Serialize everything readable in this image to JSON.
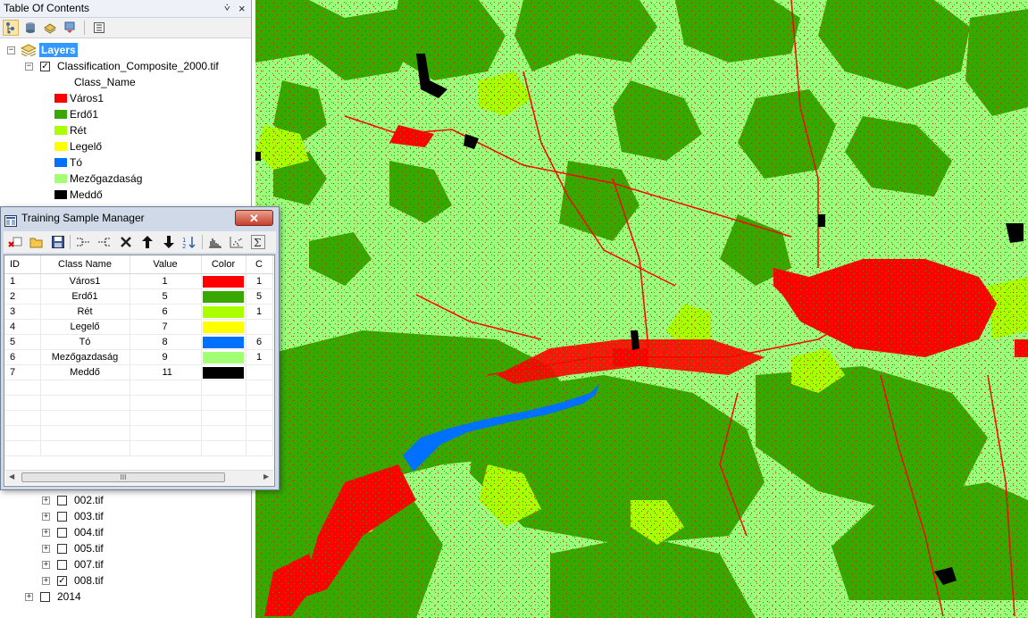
{
  "toc": {
    "title": "Table Of Contents",
    "pin_glyph": "⩒",
    "close_glyph": "×",
    "toolbar_icons": [
      "list-by-drawing-order-icon",
      "list-by-source-icon",
      "list-by-visibility-icon",
      "list-by-selection-icon",
      "options-icon"
    ],
    "layers_label": "Layers",
    "raster_layer": "Classification_Composite_2000.tif",
    "legend_field": "Class_Name",
    "legend": [
      {
        "label": "Város1",
        "color": "#ff0000"
      },
      {
        "label": "Erdő1",
        "color": "#38a800"
      },
      {
        "label": "Rét",
        "color": "#aaff00"
      },
      {
        "label": "Legelő",
        "color": "#ffff00"
      },
      {
        "label": "Tó",
        "color": "#0070ff"
      },
      {
        "label": "Mezőgazdaság",
        "color": "#a3ff73"
      },
      {
        "label": "Meddő",
        "color": "#000000"
      }
    ],
    "lower_layers": [
      {
        "label": "002.tif",
        "checked": false
      },
      {
        "label": "003.tif",
        "checked": false
      },
      {
        "label": "004.tif",
        "checked": false
      },
      {
        "label": "005.tif",
        "checked": false
      },
      {
        "label": "007.tif",
        "checked": false
      },
      {
        "label": "008.tif",
        "checked": true
      }
    ],
    "group_2014": "2014"
  },
  "training_sample_manager": {
    "title": "Training Sample Manager",
    "close_glyph": "✕",
    "toolbar_icons": [
      "delete-icon",
      "open-icon",
      "save-icon",
      "merge-icon",
      "split-icon",
      "remove-icon",
      "move-up-icon",
      "move-down-icon",
      "reset-order-icon",
      "histogram-icon",
      "scatterplot-icon",
      "statistics-icon"
    ],
    "columns": [
      "ID",
      "Class Name",
      "Value",
      "Color",
      "C"
    ],
    "rows": [
      {
        "id": "1",
        "name": "Város1",
        "value": "1",
        "color": "#ff0000",
        "c": "1"
      },
      {
        "id": "2",
        "name": "Erdő1",
        "value": "5",
        "color": "#38a800",
        "c": "5"
      },
      {
        "id": "3",
        "name": "Rét",
        "value": "6",
        "color": "#aaff00",
        "c": "1"
      },
      {
        "id": "4",
        "name": "Legelő",
        "value": "7",
        "color": "#ffff00",
        "c": ""
      },
      {
        "id": "5",
        "name": "Tó",
        "value": "8",
        "color": "#0070ff",
        "c": "6"
      },
      {
        "id": "6",
        "name": "Mezőgazdaság",
        "value": "9",
        "color": "#a3ff73",
        "c": "1"
      },
      {
        "id": "7",
        "name": "Meddő",
        "value": "11",
        "color": "#000000",
        "c": ""
      }
    ],
    "scroll_thumb_grip": "III"
  },
  "map": {
    "background_color": "#9cfc7c",
    "class_colors": {
      "urban": "#ff0000",
      "forest": "#38a800",
      "meadow": "#aaff00",
      "pasture": "#ffff00",
      "lake": "#0070ff",
      "agriculture": "#a3ff73",
      "barren": "#000000"
    }
  }
}
